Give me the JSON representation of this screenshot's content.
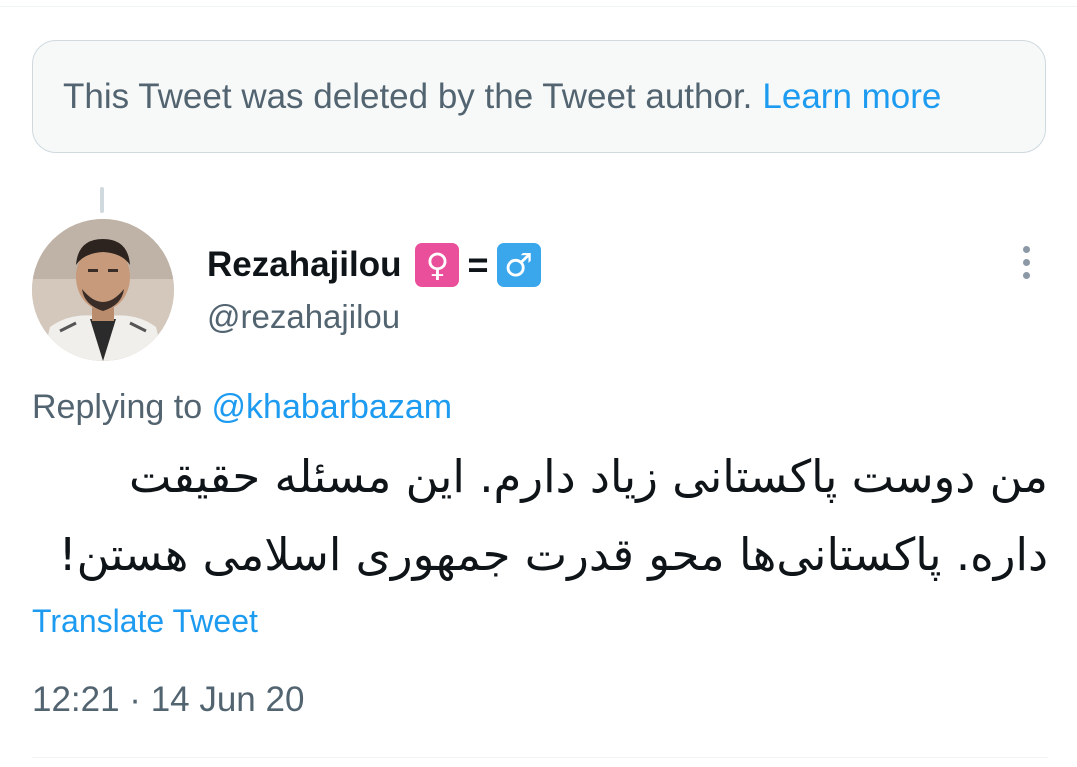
{
  "deleted_notice": {
    "text": "This Tweet was deleted by the Tweet author.",
    "link": "Learn more"
  },
  "author": {
    "display_name": "Rezahajilou",
    "emoji": [
      "♀",
      "=",
      "♂"
    ],
    "handle": "@rezahajilou"
  },
  "reply": {
    "prefix": "Replying to ",
    "mention": "@khabarbazam"
  },
  "tweet": {
    "text": "من دوست پاکستانی زیاد دارم. این مسئله حقیقت داره. پاکستانی‌ها محو قدرت جمهوری اسلامی هستن!"
  },
  "translate_label": "Translate Tweet",
  "timestamp": "12:21 · 14 Jun 20",
  "icons": [
    "more-icon"
  ],
  "colors": {
    "link": "#1d9bf0",
    "secondary_text": "#536471",
    "primary_text": "#0f1419"
  }
}
